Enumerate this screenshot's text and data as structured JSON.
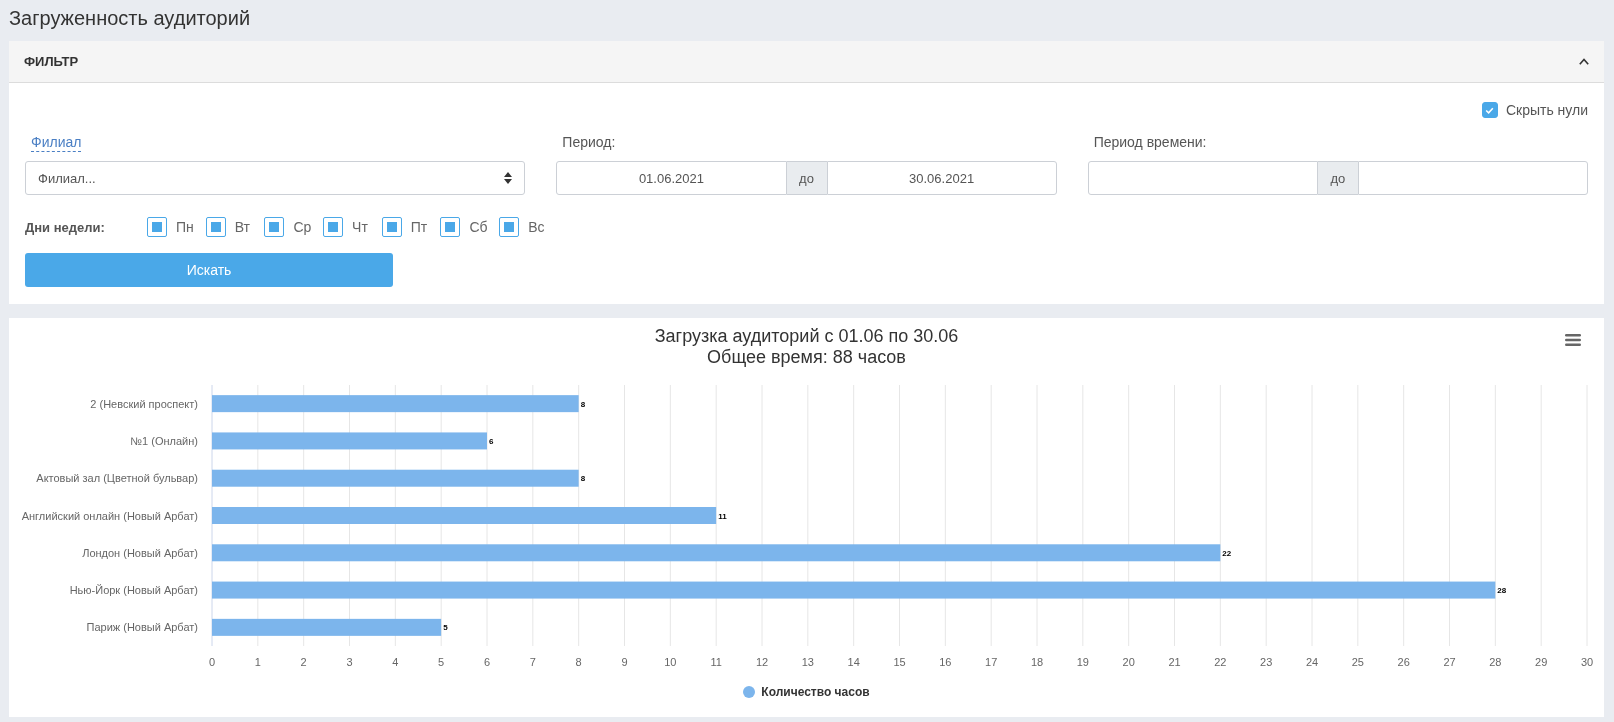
{
  "page": {
    "title": "Загруженность аудиторий"
  },
  "filter": {
    "title": "ФИЛЬТР",
    "expanded": true,
    "hide_zeros": {
      "label": "Скрыть нули",
      "checked": true
    },
    "branch": {
      "label": "Филиал",
      "value": "Филиал..."
    },
    "period": {
      "label": "Период:",
      "from": "01.06.2021",
      "separator": "до",
      "to": "30.06.2021"
    },
    "time_period": {
      "label": "Период времени:",
      "separator": "до"
    },
    "weekdays": {
      "label": "Дни недели:",
      "days": [
        {
          "label": "Пн",
          "checked": true
        },
        {
          "label": "Вт",
          "checked": true
        },
        {
          "label": "Ср",
          "checked": true
        },
        {
          "label": "Чт",
          "checked": true
        },
        {
          "label": "Пт",
          "checked": true
        },
        {
          "label": "Сб",
          "checked": true
        },
        {
          "label": "Вс",
          "checked": true
        }
      ]
    },
    "search_button": "Искать"
  },
  "chart": {
    "subtitle": "Общее время: 88 часов",
    "chart_data": {
      "type": "bar",
      "orientation": "horizontal",
      "title": "Загрузка аудиторий с 01.06 по 30.06",
      "categories": [
        "2 (Невский проспект)",
        "№1 (Онлайн)",
        "Актовый зал (Цветной бульвар)",
        "Английский онлайн (Новый Арбат)",
        "Лондон (Новый Арбат)",
        "Нью-Йорк (Новый Арбат)",
        "Париж (Новый Арбат)"
      ],
      "series": [
        {
          "name": "Количество часов",
          "color": "#7cb5ec",
          "values": [
            8,
            6,
            8,
            11,
            22,
            28,
            5
          ]
        }
      ],
      "xlim": [
        0,
        30
      ],
      "xticks": [
        0,
        1,
        2,
        3,
        4,
        5,
        6,
        7,
        8,
        9,
        10,
        11,
        12,
        13,
        14,
        15,
        16,
        17,
        18,
        19,
        20,
        21,
        22,
        23,
        24,
        25,
        26,
        27,
        28,
        29,
        30
      ],
      "grid": true,
      "data_labels": true
    }
  }
}
